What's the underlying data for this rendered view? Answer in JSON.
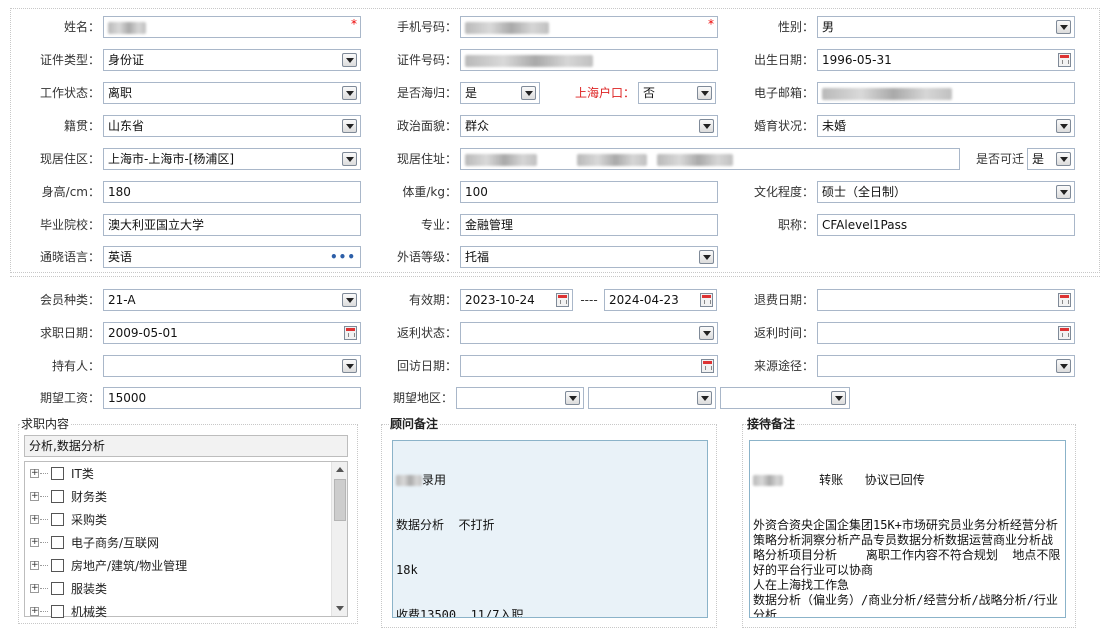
{
  "personal": {
    "name_label": "姓名：",
    "mobile_label": "手机号码：",
    "gender_label": "性别：",
    "gender_value": "男",
    "id_type_label": "证件类型：",
    "id_type_value": "身份证",
    "id_number_label": "证件号码：",
    "birth_date_label": "出生日期：",
    "birth_date_value": "1996-05-31",
    "work_status_label": "工作状态：",
    "work_status_value": "离职",
    "returnee_label": "是否海归：",
    "returnee_value": "是",
    "shanghai_hukou_label": "上海户口：",
    "shanghai_hukou_value": "否",
    "email_label": "电子邮箱：",
    "native_place_label": "籍贯：",
    "native_place_value": "山东省",
    "political_label": "政治面貌：",
    "political_value": "群众",
    "marital_label": "婚育状况：",
    "marital_value": "未婚",
    "residence_area_label": "现居住区：",
    "residence_area_value": "上海市-上海市-[杨浦区]",
    "address_label": "现居住址：",
    "relocate_label": "是否可迁",
    "relocate_value": "是",
    "height_label": "身高/cm：",
    "height_value": "180",
    "weight_label": "体重/kg：",
    "weight_value": "100",
    "education_label": "文化程度：",
    "education_value": "硕士（全日制）",
    "school_label": "毕业院校：",
    "school_value": "澳大利亚国立大学",
    "major_label": "专业：",
    "major_value": "金融管理",
    "title_label": "职称：",
    "title_value": "CFAlevel1Pass",
    "language_label": "通晓语言：",
    "language_value": "英语",
    "language_picker": "•••",
    "lang_level_label": "外语等级：",
    "lang_level_value": "托福"
  },
  "membership": {
    "member_type_label": "会员种类：",
    "member_type_value": "21-A",
    "validity_label": "有效期：",
    "validity_start": "2023-10-24",
    "validity_separator": "----",
    "validity_end": "2024-04-23",
    "refund_date_label": "退费日期：",
    "job_date_label": "求职日期：",
    "job_date_value": "2009-05-01",
    "rebate_status_label": "返利状态：",
    "rebate_time_label": "返利时间：",
    "holder_label": "持有人：",
    "visit_date_label": "回访日期：",
    "source_label": "来源途径：",
    "salary_label": "期望工资：",
    "salary_value": "15000",
    "region_label": "期望地区："
  },
  "job_content": {
    "title": "求职内容",
    "summary": "分析,数据分析",
    "tree": [
      {
        "label": "IT类"
      },
      {
        "label": "财务类"
      },
      {
        "label": "采购类"
      },
      {
        "label": "电子商务/互联网"
      },
      {
        "label": "房地产/建筑/物业管理"
      },
      {
        "label": "服装类"
      },
      {
        "label": "机械类"
      }
    ],
    "expander_symbol": "+"
  },
  "consultant_note": {
    "title": "顾问备注",
    "lines": [
      "录用",
      "数据分析  不打折",
      "18k",
      "收费13500  11/7入职"
    ]
  },
  "reception_note": {
    "title": "接待备注",
    "text_line1": "     转账   协议已回传",
    "text_rest": "外资合资央企国企集团15K+市场研究员业务分析经营分析策略分析洞察分析产品专员数据分析数据运营商业分析战略分析项目分析    离职工作内容不符合规划  地点不限  好的平台行业可以协商\n人在上海找工作急\n数据分析（偏业务）/商业分析/经营分析/战略分析/行业分析"
  },
  "colors": {
    "border": "#a9b7c9",
    "accent_red": "#d22",
    "note_blue": "#e9f2f8",
    "note_border": "#8bb3c9"
  }
}
